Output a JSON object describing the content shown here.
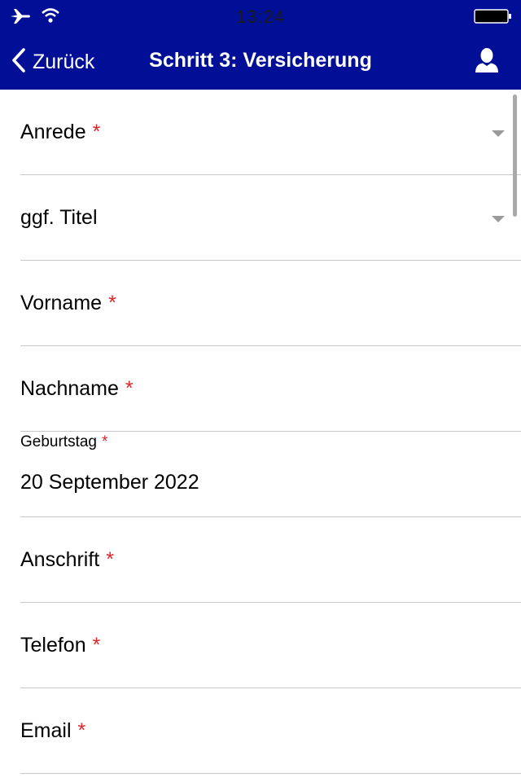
{
  "status_bar": {
    "time": "13:24",
    "icons": [
      "airplane-icon",
      "wifi-icon",
      "battery-icon"
    ]
  },
  "nav": {
    "back_label": "Zurück",
    "title": "Schritt 3: Versicherung",
    "right_icon": "user-icon"
  },
  "colors": {
    "nav_background": "#000f96",
    "required_marker": "#e0252b",
    "separator": "#c8c8cc"
  },
  "form": {
    "required_marker": "*",
    "fields": [
      {
        "label": "Anrede",
        "type": "select",
        "required": true,
        "value": ""
      },
      {
        "label": "ggf. Titel",
        "type": "select",
        "required": false,
        "value": ""
      },
      {
        "label": "Vorname",
        "type": "text",
        "required": true,
        "value": ""
      },
      {
        "label": "Nachname",
        "type": "text",
        "required": true,
        "value": ""
      },
      {
        "label": "Geburtstag",
        "type": "date",
        "required": true,
        "value": "20 September 2022"
      },
      {
        "label": "Anschrift",
        "type": "text",
        "required": true,
        "value": ""
      },
      {
        "label": "Telefon",
        "type": "text",
        "required": true,
        "value": ""
      },
      {
        "label": "Email",
        "type": "text",
        "required": true,
        "value": ""
      }
    ]
  }
}
